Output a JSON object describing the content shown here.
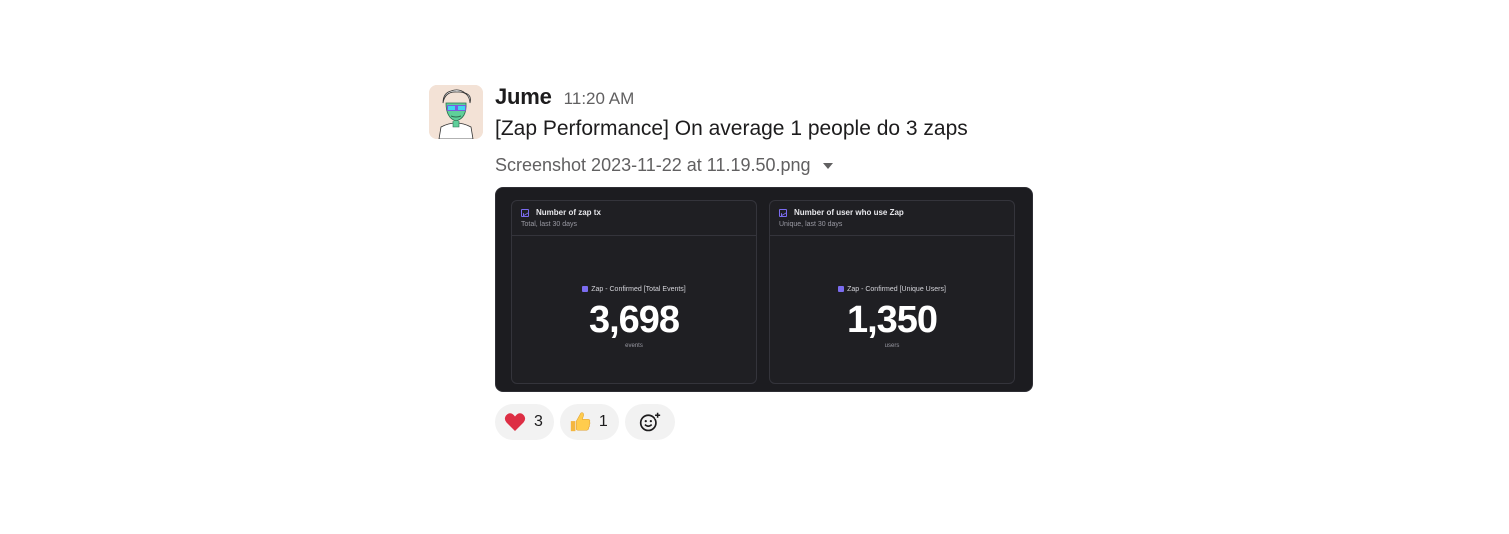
{
  "message": {
    "username": "Jume",
    "timestamp": "11:20 AM",
    "text": "[Zap Performance] On average 1 people do 3 zaps",
    "file_name": "Screenshot 2023-11-22 at 11.19.50.png"
  },
  "attachment": {
    "cards": [
      {
        "title": "Number of zap tx",
        "subtitle": "Total, last 30 days",
        "legend": "Zap - Confirmed [Total Events]",
        "value": "3,698",
        "unit": "events"
      },
      {
        "title": "Number of user who use Zap",
        "subtitle": "Unique, last 30 days",
        "legend": "Zap - Confirmed [Unique Users]",
        "value": "1,350",
        "unit": "users"
      }
    ],
    "accent_color": "#7b6cf0"
  },
  "reactions": [
    {
      "emoji": "heart-icon",
      "count": "3"
    },
    {
      "emoji": "thumbs-up-icon",
      "count": "1"
    },
    {
      "emoji": "add-reaction-icon"
    }
  ]
}
